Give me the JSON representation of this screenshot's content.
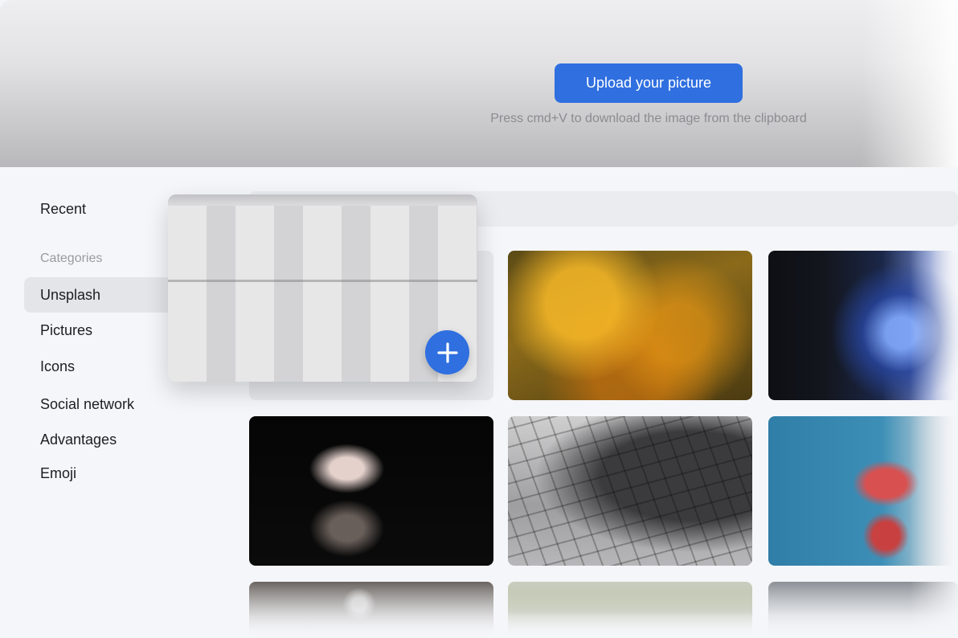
{
  "header": {
    "upload_label": "Upload your picture",
    "hint": "Press cmd+V to download the image from the clipboard"
  },
  "sidebar": {
    "recent": "Recent",
    "categories_title": "Categories",
    "items": [
      {
        "label": "Unsplash",
        "active": true
      },
      {
        "label": "Pictures"
      },
      {
        "label": "Icons"
      },
      {
        "label": "Social network"
      },
      {
        "label": "Advantages"
      },
      {
        "label": "Emoji"
      }
    ]
  },
  "colors": {
    "accent": "#2f6fe0"
  },
  "icons": {
    "add": "plus-icon"
  }
}
